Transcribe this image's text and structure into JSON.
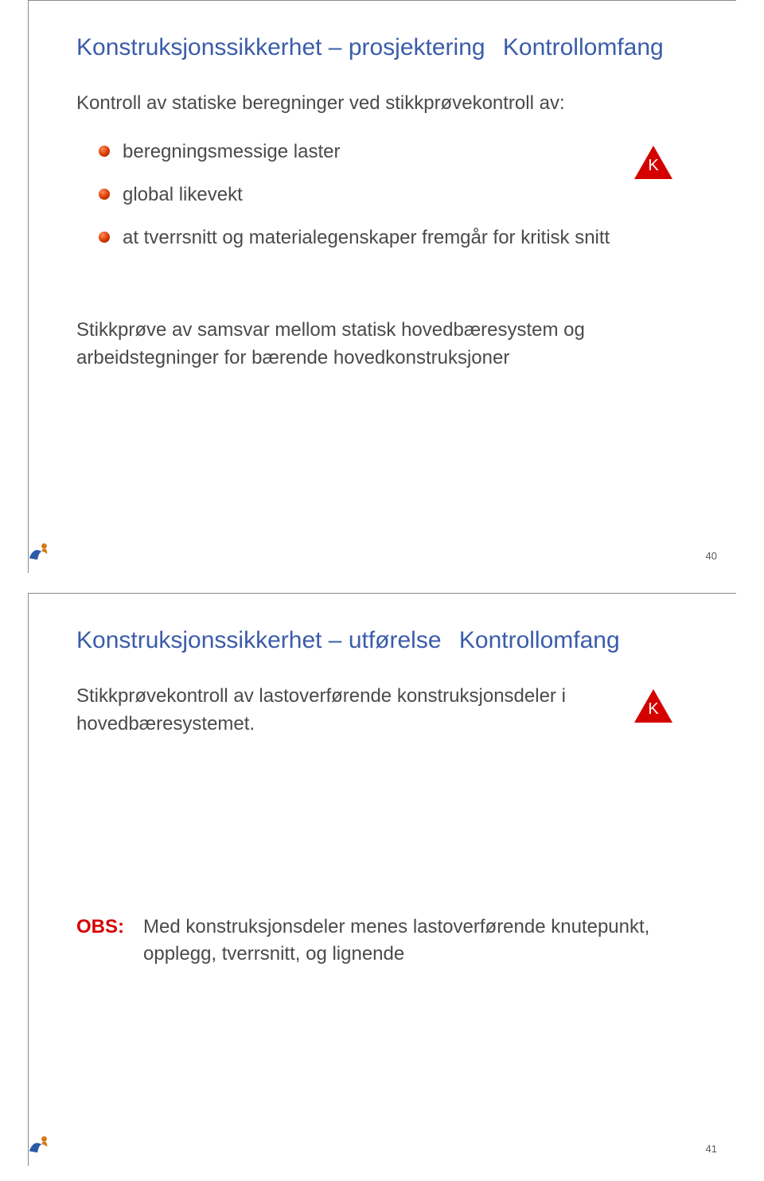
{
  "slide1": {
    "title_part1": "Konstruksjonssikkerhet – prosjektering",
    "title_part2": "Kontrollomfang",
    "subtitle": "Kontroll av statiske beregninger ved stikkprøvekontroll av:",
    "bullets": [
      "beregningsmessige laster",
      "global likevekt",
      "at tverrsnitt og materialegenskaper fremgår for kritisk snitt"
    ],
    "triangle_letter": "K",
    "paragraph": "Stikkprøve av samsvar mellom statisk hovedbæresystem og arbeidstegninger for bærende hovedkonstruksjoner",
    "page_number": "40"
  },
  "slide2": {
    "title_part1": "Konstruksjonssikkerhet – utførelse",
    "title_part2": "Kontrollomfang",
    "body": "Stikkprøvekontroll av lastoverførende konstruksjonsdeler i hovedbæresystemet.",
    "triangle_letter": "K",
    "obs_label": "OBS:",
    "obs_text": "Med konstruksjonsdeler menes lastoverførende knutepunkt, opplegg, tverrsnitt, og lignende",
    "page_number": "41"
  }
}
